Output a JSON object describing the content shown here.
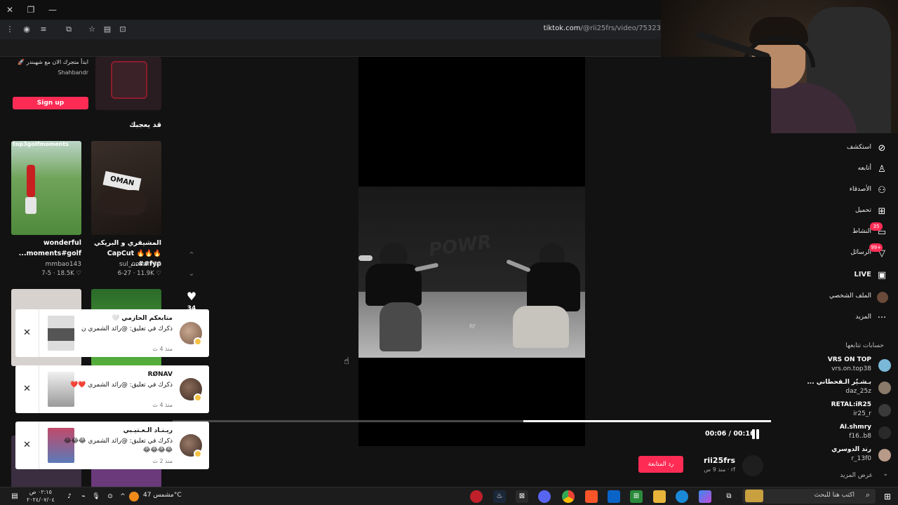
{
  "browser": {
    "url_host": "tiktok.com",
    "url_path": "/@rii25frs/video/75323"
  },
  "left": {
    "promo_text": "ابدأ متجرك الان مع شهبندر 🚀",
    "promo_sub": "Shahbandr",
    "signup_label": "Sign up",
    "section_title": "قد يعجبك",
    "cards": [
      {
        "title": "المشيقري و البريكي 🔥🔥🔥 CapCut #fyp#...",
        "user": "sul_oman789",
        "meta": "6-27 · 11.9K ♡"
      },
      {
        "title": "wonderful moments#golf...",
        "user": "mmbao143",
        "meta": "7-5 · 18.5K ♡"
      }
    ],
    "thumb_text_1": "OMAN",
    "thumb_text_2": "top3golfmoments"
  },
  "video": {
    "watermark": "POWR",
    "corner_mark": "Rf",
    "time_label": "00:06 / 00:16",
    "progress_fraction": 0.414,
    "like_count": "34"
  },
  "author": {
    "name": "rii25frs",
    "meta": "rf · منذ 9 س",
    "follow_label": "رد المتابعة"
  },
  "notifications": [
    {
      "name": "متابعكم الحازمي 🤍",
      "body": "ذكرك في تعليق: @رائد الشمري ن",
      "time": "منذ 4 ث"
    },
    {
      "name": "RØNAV",
      "body": "ذكرك في تعليق: @رائد الشمري ❤️❤️",
      "time": "منذ 4 ث"
    },
    {
      "name": "ريـنـاد الـعـتيـبي",
      "body": "ذكرك في تعليق: @رائد الشمري 😂😂😂😂😂😂😂",
      "time": "منذ 2 ث"
    }
  ],
  "sidebar": {
    "nav": [
      {
        "label": "استكشف",
        "icon": "compass-icon"
      },
      {
        "label": "أتابعه",
        "icon": "user-follow-icon"
      },
      {
        "label": "الأصدقاء",
        "icon": "friends-icon"
      },
      {
        "label": "تحميل",
        "icon": "upload-icon"
      },
      {
        "label": "النشاط",
        "icon": "activity-icon",
        "badge": "35"
      },
      {
        "label": "الرسائل",
        "icon": "messages-icon",
        "badge": "99+"
      },
      {
        "label": "LIVE",
        "icon": "live-icon"
      },
      {
        "label": "الملف الشخصي",
        "icon": "profile-icon"
      },
      {
        "label": "المزيد",
        "icon": "more-icon"
      }
    ],
    "following_title": "حسابات تتابعها",
    "following": [
      {
        "name": "VRS ON TOP",
        "handle": "vrs.on.top38"
      },
      {
        "name": "بـشـيٌر الـقحطاني ...",
        "handle": "daz_25z"
      },
      {
        "name": "RETAL:iR25",
        "handle": "ir25_r"
      },
      {
        "name": "AI.shmry",
        "handle": "f16..b8"
      },
      {
        "name": "رند الدوسري",
        "handle": "r_13f0"
      }
    ],
    "see_more": "عرض المزيد"
  },
  "taskbar": {
    "search_placeholder": "اكتب هنا للبحث",
    "weather": "مشمس 47°C",
    "clock_time": "٠٢:١٥ ص",
    "clock_date": "٢٠٢٤/٠٧/٠٤"
  },
  "colors": {
    "accent": "#fe2c55",
    "background": "#121212"
  }
}
